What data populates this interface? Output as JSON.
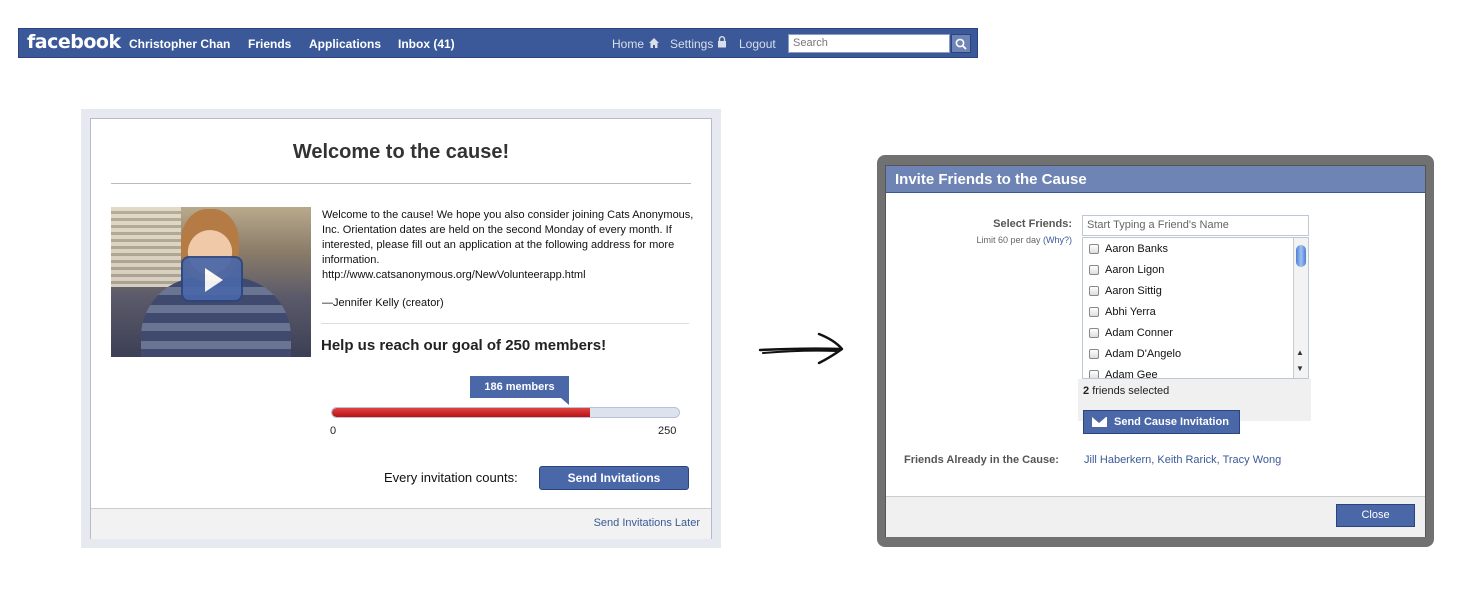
{
  "topbar": {
    "logo": "facebook",
    "nav": [
      "Christopher Chan",
      "Friends",
      "Applications",
      "Inbox (41)"
    ],
    "right_nav": {
      "home": "Home",
      "settings": "Settings",
      "logout": "Logout"
    },
    "search_placeholder": "Search",
    "icons": [
      "home-icon",
      "lock-icon",
      "search-icon"
    ],
    "bg_color": "#3b5998"
  },
  "welcome_dialog": {
    "title": "Welcome to the cause!",
    "description": "Welcome to the cause!  We hope you also consider joining Cats Anonymous, Inc.  Orientation dates are held on the second Monday of every month.  If interested, please fill out an application at the following address for more information.",
    "url": "http://www.catsanonymous.org/NewVolunteerapp.html",
    "creator": "—Jennifer Kelly (creator)",
    "goal_heading": "Help us reach our goal of 250 members!",
    "progress": {
      "label": "186 members",
      "current": 186,
      "min": 0,
      "max": 250,
      "min_label": "0",
      "max_label": "250"
    },
    "invite_prompt": "Every invitation counts:",
    "send_button": "Send Invitations",
    "later_link": "Send Invitations Later"
  },
  "invite_dialog": {
    "title": "Invite Friends to the Cause",
    "select_label": "Select Friends:",
    "limit_text": "Limit 60 per day",
    "limit_link": "(Why?)",
    "input_placeholder": "Start Typing a Friend's Name",
    "friends": [
      "Aaron Banks",
      "Aaron Ligon",
      "Aaron Sittig",
      "Abhi Yerra",
      "Adam Conner",
      "Adam D'Angelo",
      "Adam Gee"
    ],
    "selected_count": "2",
    "selected_suffix": "friends selected",
    "send_button": "Send Cause Invitation",
    "already_label": "Friends Already in the Cause:",
    "already_names": "Jill Haberkern, Keith Rarick, Tracy Wong",
    "close_button": "Close"
  }
}
